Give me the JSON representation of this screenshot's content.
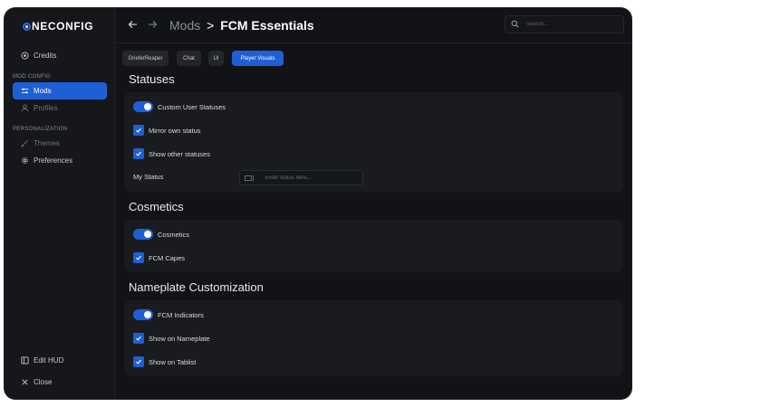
{
  "app": {
    "logo": "NECONFIG"
  },
  "sidebar": {
    "credits": "Credits",
    "section_mod_config": "MOD CONFIG",
    "mods": "Mods",
    "profiles": "Profiles",
    "section_personalization": "PERSONALIZATION",
    "themes": "Themes",
    "preferences": "Preferences",
    "edit_hud": "Edit HUD",
    "close": "Close"
  },
  "header": {
    "breadcrumb_parent": "Mods",
    "breadcrumb_sep": ">",
    "breadcrumb_current": "FCM Essentials",
    "search_placeholder": "Search..."
  },
  "tabs": [
    {
      "label": "GrieferReaper",
      "active": false
    },
    {
      "label": "Chat",
      "active": false
    },
    {
      "label": "UI",
      "active": false
    },
    {
      "label": "Player Visuals",
      "active": true
    }
  ],
  "sections": {
    "statuses": {
      "title": "Statuses",
      "custom_user_statuses": "Custom User Statuses",
      "mirror_own_status": "Mirror own status",
      "show_other_statuses": "Show other statuses",
      "my_status_label": "My Status",
      "my_status_placeholder": "Enter status here..."
    },
    "cosmetics": {
      "title": "Cosmetics",
      "cosmetics": "Cosmetics",
      "fcm_capes": "FCM Capes"
    },
    "nameplate": {
      "title": "Nameplate Customization",
      "fcm_indicators": "FCM Indicators",
      "show_on_nameplate": "Show on Nameplate",
      "show_on_tablist": "Show on Tablist"
    }
  },
  "colors": {
    "accent": "#1f5fd6",
    "background": "#121317",
    "card": "#1a1b20"
  }
}
